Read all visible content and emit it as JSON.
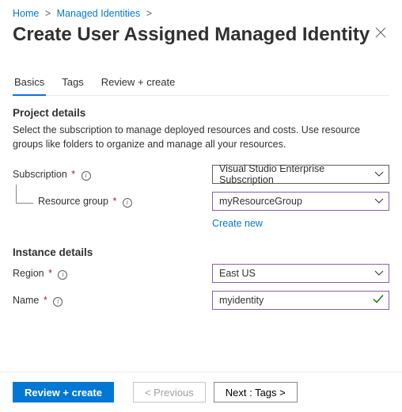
{
  "breadcrumb": {
    "home": "Home",
    "managed": "Managed Identities"
  },
  "page_title": "Create User Assigned Managed Identity",
  "tabs": {
    "basics": "Basics",
    "tags": "Tags",
    "review": "Review + create"
  },
  "project_details": {
    "heading": "Project details",
    "description": "Select the subscription to manage deployed resources and costs. Use resource groups like folders to organize and manage all your resources.",
    "subscription_label": "Subscription",
    "subscription_value": "Visual Studio Enterprise Subscription",
    "resource_group_label": "Resource group",
    "resource_group_value": "myResourceGroup",
    "create_new": "Create new"
  },
  "instance_details": {
    "heading": "Instance details",
    "region_label": "Region",
    "region_value": "East US",
    "name_label": "Name",
    "name_value": "myidentity"
  },
  "footer": {
    "review": "Review + create",
    "previous": "< Previous",
    "next": "Next : Tags >"
  }
}
